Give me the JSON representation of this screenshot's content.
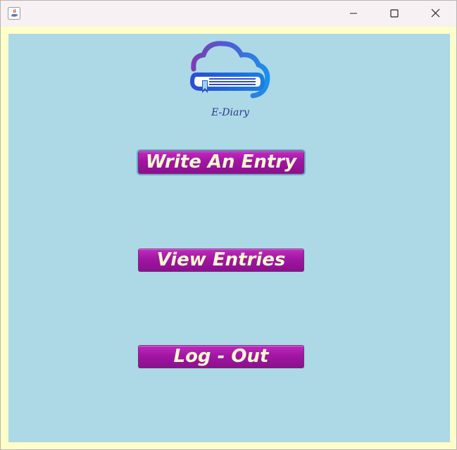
{
  "window": {
    "controls": {
      "minimize_icon": "minimize-icon",
      "maximize_icon": "maximize-icon",
      "close_icon": "close-icon"
    }
  },
  "logo": {
    "caption": "E-Diary"
  },
  "buttons": {
    "write": "Write An Entry",
    "view": "View Entries",
    "logout": "Log - Out"
  },
  "colors": {
    "panel_background": "#add8e6",
    "frame_background": "#fefec8",
    "button_background": "#a116a2",
    "button_text": "#fffad0"
  }
}
